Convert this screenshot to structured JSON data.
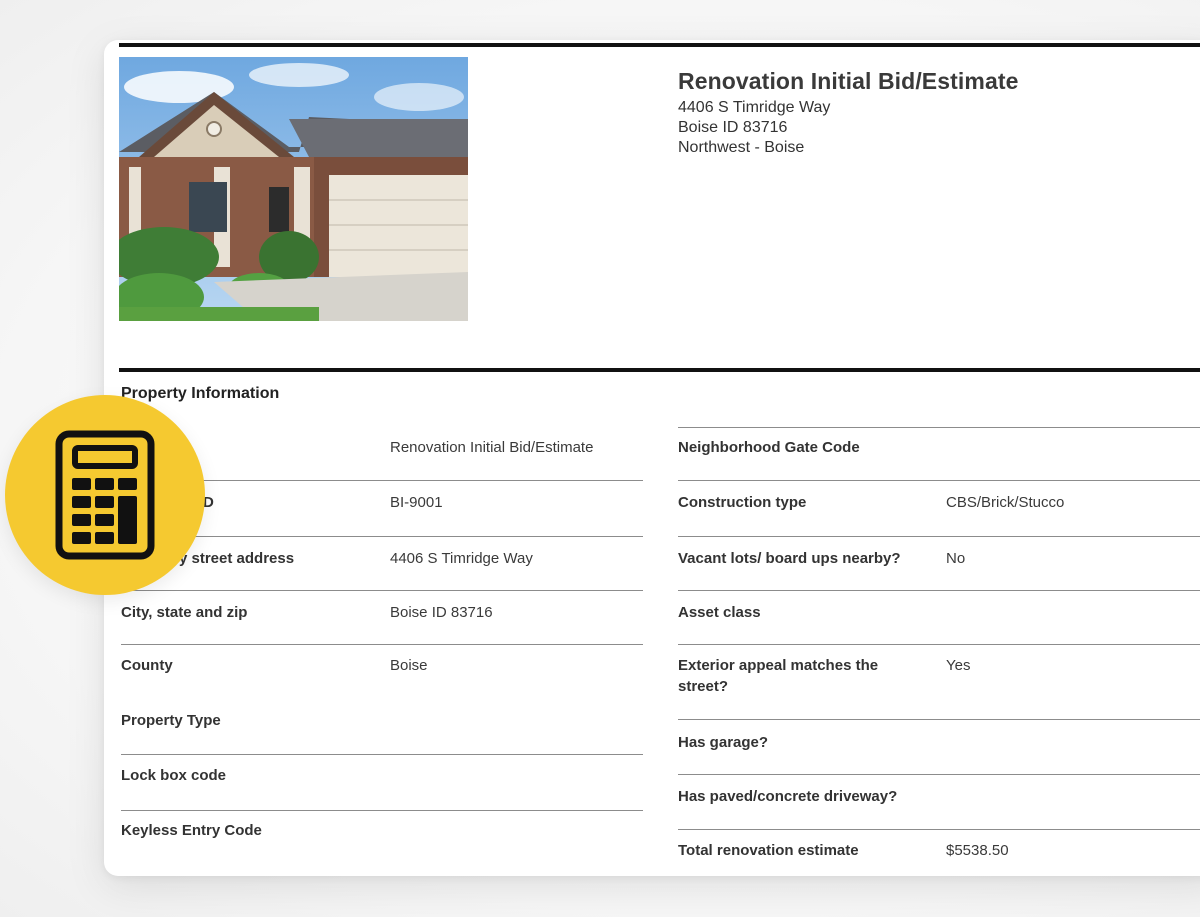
{
  "document": {
    "title": "Renovation Initial Bid/Estimate",
    "address_line1": "4406 S Timridge Way",
    "address_line2": "Boise ID 83716",
    "address_line3": "Northwest - Boise"
  },
  "section": {
    "title": "Property Information"
  },
  "left_fields": [
    {
      "label": "",
      "value": "Renovation Initial Bid/Estimate"
    },
    {
      "label": "D",
      "value": "BI-9001"
    },
    {
      "label": "y street address",
      "value": "4406 S Timridge Way"
    },
    {
      "label": "City, state and zip",
      "value": "Boise ID 83716"
    },
    {
      "label": "County",
      "value": "Boise"
    },
    {
      "label": "Property Type",
      "value": ""
    },
    {
      "label": "Lock box code",
      "value": ""
    },
    {
      "label": "Keyless Entry Code",
      "value": ""
    }
  ],
  "right_fields": [
    {
      "label": "Neighborhood Gate Code",
      "value": ""
    },
    {
      "label": "Construction type",
      "value": "CBS/Brick/Stucco"
    },
    {
      "label": "Vacant lots/ board ups nearby?",
      "value": "No"
    },
    {
      "label": "Asset class",
      "value": ""
    },
    {
      "label": "Exterior appeal matches the",
      "label2": "street?",
      "value": "Yes"
    },
    {
      "label": "Has garage?",
      "value": ""
    },
    {
      "label": "Has paved/concrete driveway?",
      "value": ""
    },
    {
      "label": "Total renovation estimate",
      "value": "$5538.50"
    }
  ],
  "icons": {
    "badge": "calculator-icon",
    "photo": "house-photo"
  },
  "colors": {
    "badge": "#f5c930",
    "rule": "#111111"
  }
}
